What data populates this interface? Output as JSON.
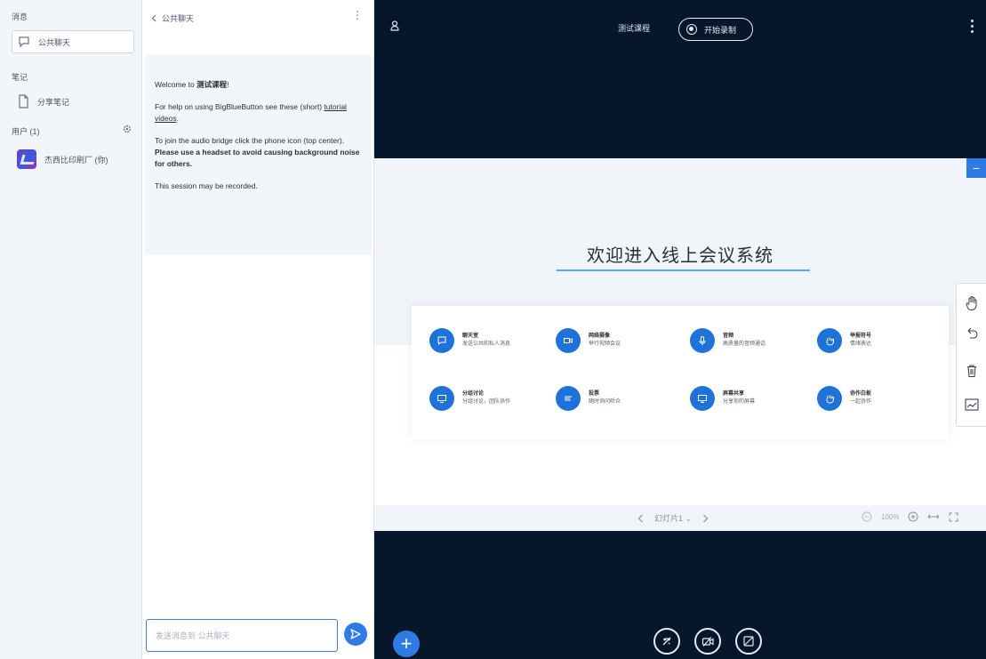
{
  "userlist": {
    "messages_title": "消息",
    "public_chat_label": "公共聊天",
    "notes_title": "笔记",
    "shared_notes_label": "分享笔记",
    "users_title": "用户 (1)",
    "user_name": "杰西比印刷厂 (你)"
  },
  "chat": {
    "back_label": "公共聊天",
    "welcome_prefix": "Welcome to ",
    "course_name": "测试课程",
    "welcome_suffix": "!",
    "help_text_1": "For help on using BigBlueButton see these (short) ",
    "help_link": "tutorial videos",
    "help_text_2": ".",
    "audio_text_1": "To join the audio bridge click the phone icon (top center). ",
    "audio_text_bold": "Please use a headset to avoid causing background noise for others.",
    "recorded_text": "This session may be recorded.",
    "input_placeholder": "发送消息到 公共聊天"
  },
  "stage": {
    "meeting_title": "测试课程",
    "record_label": "开始录制",
    "slide_title": "欢迎进入线上会议系统",
    "features": [
      {
        "title": "聊天室",
        "desc": "发送公共和私人消息"
      },
      {
        "title": "网络摄像",
        "desc": "举行视频会议"
      },
      {
        "title": "音频",
        "desc": "高质量的音频通话"
      },
      {
        "title": "举报符号",
        "desc": "情绪表达"
      },
      {
        "title": "分组讨论",
        "desc": "分组讨论，团队协作"
      },
      {
        "title": "投票",
        "desc": "随时询问听众"
      },
      {
        "title": "屏幕共享",
        "desc": "分享你的屏幕"
      },
      {
        "title": "协作白板",
        "desc": "一起协作"
      }
    ],
    "slide_nav_label": "幻灯片1",
    "zoom_label": "100%"
  },
  "colors": {
    "accent": "#2f7be6",
    "stage_bg": "#06172b",
    "feature_circle": "#1f72d8"
  }
}
